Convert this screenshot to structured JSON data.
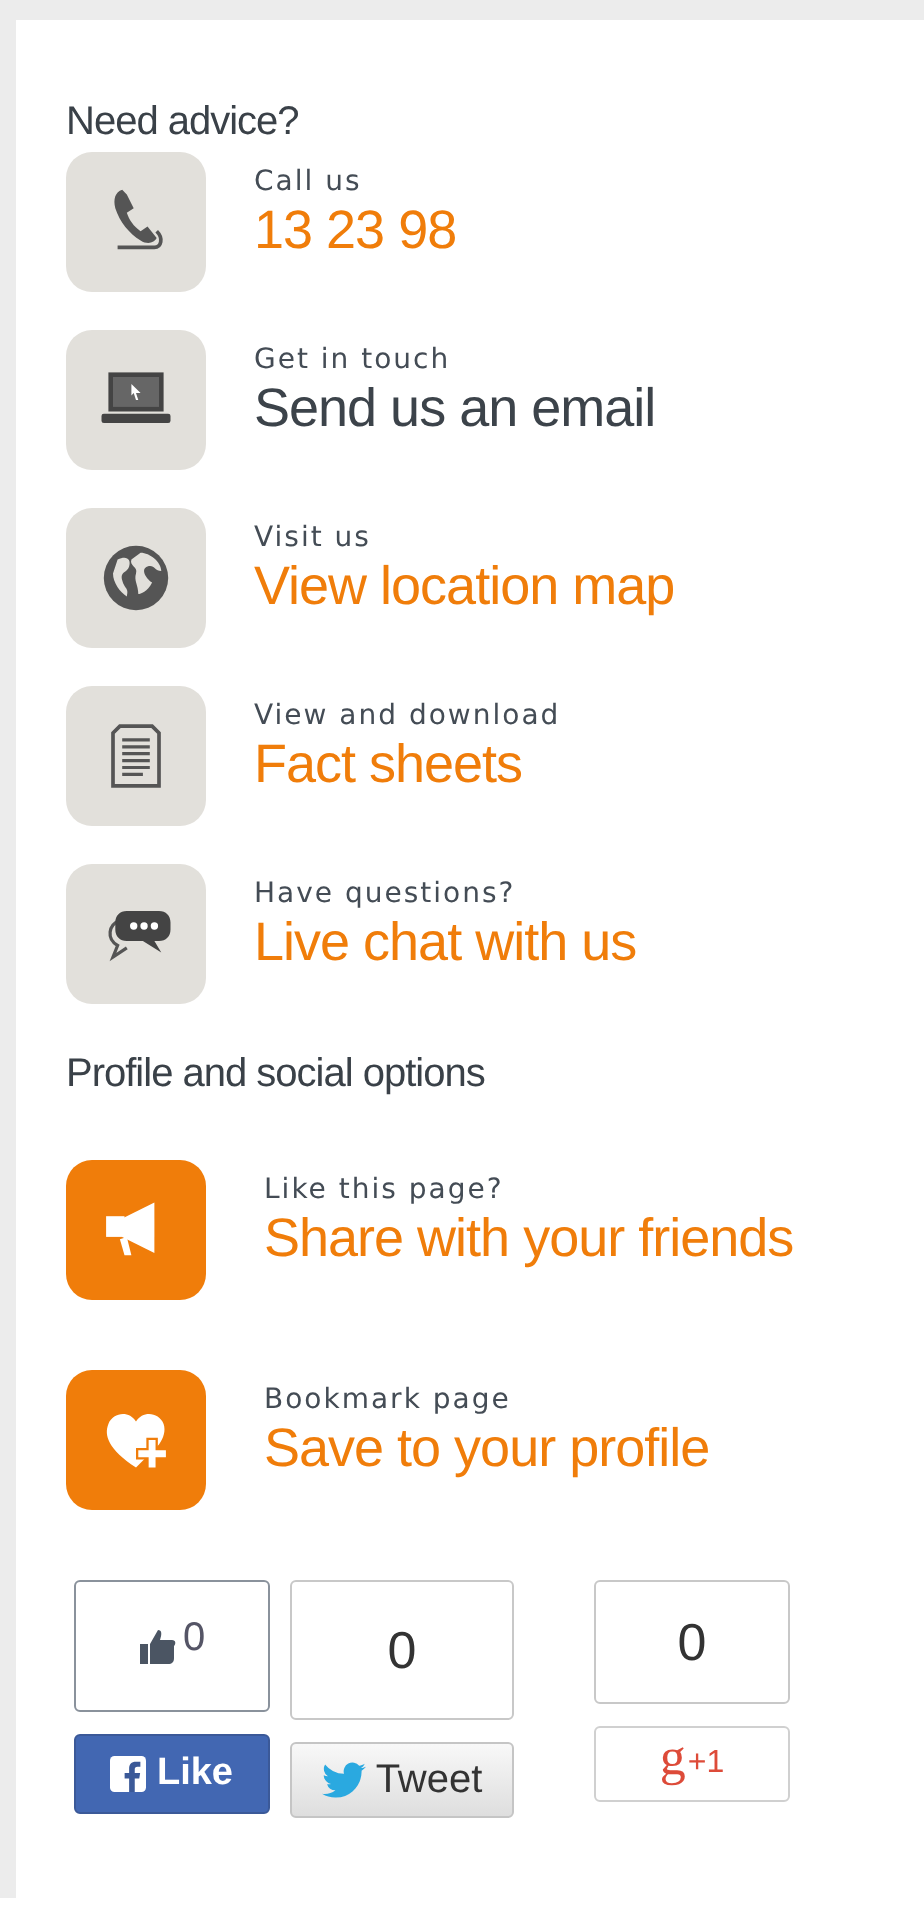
{
  "sections": [
    {
      "heading": "Need advice?",
      "kind": "contact",
      "items": [
        {
          "kind": "phone",
          "label": "Call us",
          "action": "13 23 98",
          "color": "#f07d0a"
        },
        {
          "kind": "laptop",
          "label": "Get in touch",
          "action": "Send us an email",
          "color": "#3c434a"
        },
        {
          "kind": "globe",
          "label": "Visit us",
          "action": "View location map",
          "color": "#f07d0a"
        },
        {
          "kind": "document",
          "label": "View and download",
          "action": "Fact sheets",
          "color": "#f07d0a"
        },
        {
          "kind": "chat",
          "label": "Have questions?",
          "action": "Live chat with us",
          "color": "#f07d0a"
        }
      ]
    },
    {
      "heading": "Profile and social options",
      "kind": "profile",
      "items": [
        {
          "kind": "megaphone",
          "label": "Like this page?",
          "action": "Share with your friends",
          "color": "#f07d0a"
        },
        {
          "kind": "heart",
          "label": "Bookmark page",
          "action": "Save to your profile",
          "color": "#f07d0a"
        }
      ]
    }
  ],
  "social": [
    {
      "kind": "facebook",
      "count": "0",
      "label": "Like"
    },
    {
      "kind": "twitter",
      "count": "0",
      "label": "Tweet"
    },
    {
      "kind": "google",
      "count": "0",
      "logo": "g",
      "label": "+1"
    }
  ]
}
